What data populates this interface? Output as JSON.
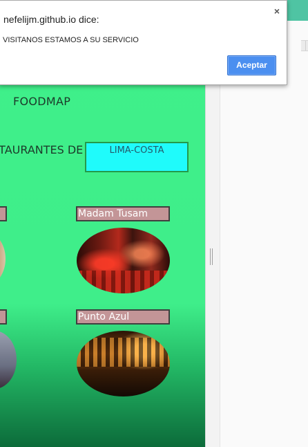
{
  "alert": {
    "title": "nefelijm.github.io dice:",
    "message": "VISITANOS ESTAMOS A SU SERVICIO",
    "ok_label": "Aceptar",
    "close_glyph": "×"
  },
  "site": {
    "brand": "FOODMAP",
    "heading": "STAURANTES DE",
    "region_button": "LIMA-COSTA"
  },
  "restaurants": [
    {
      "name": "Madam Tusam"
    },
    {
      "name": "Punto Azul"
    }
  ],
  "colors": {
    "page_bg": "#3ff08a",
    "region_button_bg": "#1ffbfb",
    "label_bg": "#c39597",
    "accept_button": "#4b8ff0"
  },
  "icons": {
    "close": "close-icon"
  }
}
